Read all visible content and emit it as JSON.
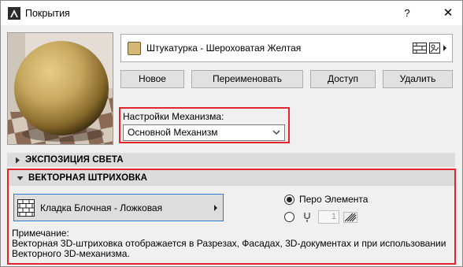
{
  "window": {
    "title": "Покрытия",
    "help_label": "?",
    "close_label": "✕"
  },
  "surface": {
    "name": "Штукатурка - Шероховатая Желтая",
    "swatch_color": "#d5b777"
  },
  "buttons": {
    "new": "Новое",
    "rename": "Переименовать",
    "access": "Доступ",
    "delete": "Удалить"
  },
  "engine": {
    "label": "Настройки Механизма:",
    "selected": "Основной Механизм"
  },
  "sections": {
    "light": "ЭКСПОЗИЦИЯ СВЕТА",
    "vector": "ВЕКТОРНАЯ ШТРИХОВКА"
  },
  "vector": {
    "hatch_name": "Кладка Блочная - Ложковая",
    "pen_element_label": "Перо Элемента",
    "pen_value": "1",
    "note_title": "Примечание:",
    "note_text": "Векторная 3D-штриховка отображается в Разрезах, Фасадах, 3D-документах и при использовании Векторного 3D-механизма."
  },
  "colors": {
    "accent_red": "#e2262c",
    "select_blue": "#2c7bd1"
  }
}
